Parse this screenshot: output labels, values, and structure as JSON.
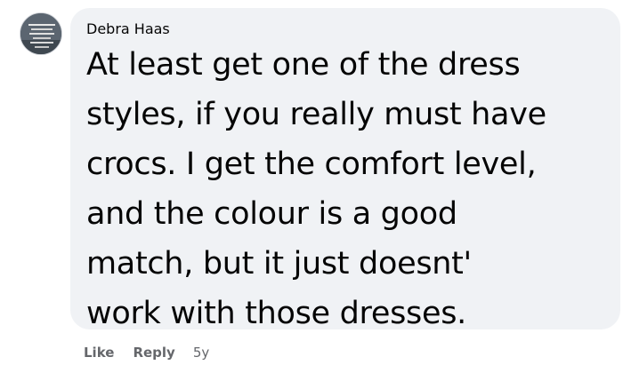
{
  "comment": {
    "author": "Debra Haas",
    "avatar_icon": "profile-photo-icon",
    "text_lines": [
      "At least get one of the dress",
      "styles, if you really must have",
      "crocs. I get the comfort level,",
      "and the colour is a good",
      "match, but it just doesnt'",
      "work with those dresses."
    ],
    "actions": {
      "like_label": "Like",
      "reply_label": "Reply",
      "timestamp": "5y"
    }
  },
  "colors": {
    "bubble_background": "#f0f2f5",
    "text": "#050505",
    "secondary_text": "#65676b"
  }
}
